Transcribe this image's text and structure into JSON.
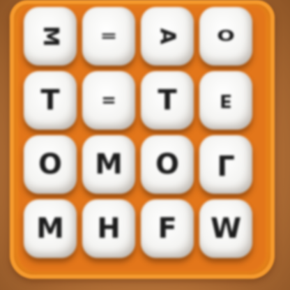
{
  "board": {
    "tray_color": "#f08a1c",
    "die_color": "#f4f4f2",
    "letter_color": "#1c1c1c",
    "rows": [
      [
        "M",
        "=",
        "A",
        "O"
      ],
      [
        "T",
        "=",
        "T",
        "E"
      ],
      [
        "O",
        "M",
        "O",
        "L"
      ],
      [
        "M",
        "H",
        "F",
        "W"
      ]
    ]
  }
}
